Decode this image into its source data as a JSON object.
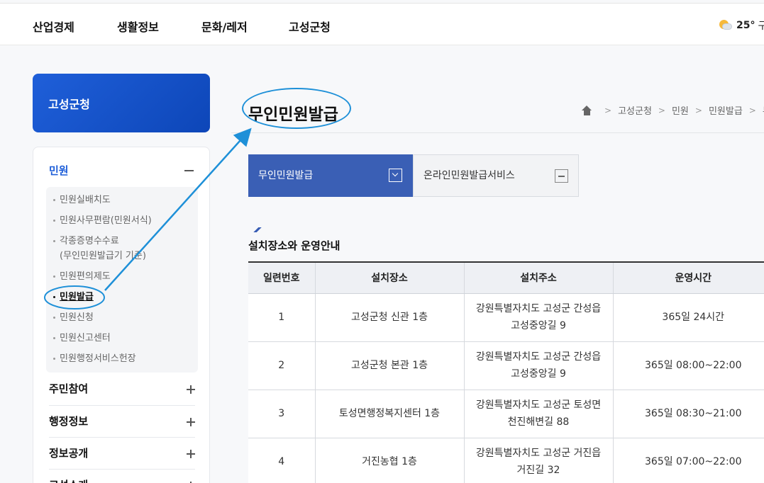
{
  "topnav": {
    "items": [
      "산업경제",
      "생활정보",
      "문화/레저",
      "고성군청"
    ],
    "weather_temp": "25°",
    "weather_extra": "구"
  },
  "sidebar": {
    "title": "고성군청",
    "section": "민원",
    "sub_items": [
      {
        "line1": "민원실배치도",
        "line2": ""
      },
      {
        "line1": "민원사무편람(민원서식)",
        "line2": ""
      },
      {
        "line1": "각종증명수수료",
        "line2": "(무인민원발급기 기준)"
      },
      {
        "line1": "민원편의제도",
        "line2": ""
      },
      {
        "line1": "민원발급",
        "line2": ""
      },
      {
        "line1": "민원신청",
        "line2": ""
      },
      {
        "line1": "민원신고센터",
        "line2": ""
      },
      {
        "line1": "민원행정서비스헌장",
        "line2": ""
      }
    ],
    "menus": [
      "주민참여",
      "행정정보",
      "정보공개",
      "고성소개"
    ]
  },
  "main": {
    "page_title": "무인민원발급",
    "breadcrumb": [
      "고성군청",
      "민원",
      "민원발급",
      "무"
    ],
    "tabs": [
      {
        "label": "무인민원발급"
      },
      {
        "label": "온라인민원발급서비스"
      }
    ],
    "section_title": "설치장소와 운영안내",
    "table": {
      "headers": [
        "일련번호",
        "설치장소",
        "설치주소",
        "운영시간"
      ],
      "rows": [
        {
          "no": "1",
          "place": "고성군청 신관 1층",
          "addr1": "강원특별자치도 고성군 간성읍",
          "addr2": "고성중앙길 9",
          "hours": "365일 24시간"
        },
        {
          "no": "2",
          "place": "고성군청 본관 1층",
          "addr1": "강원특별자치도 고성군 간성읍",
          "addr2": "고성중앙길 9",
          "hours": "365일 08:00~22:00"
        },
        {
          "no": "3",
          "place": "토성면행정복지센터 1층",
          "addr1": "강원특별자치도 고성군 토성면",
          "addr2": "천진해변길 88",
          "hours": "365일 08:30~21:00"
        },
        {
          "no": "4",
          "place": "거진농협 1층",
          "addr1": "강원특별자치도 고성군 거진읍",
          "addr2": "거진길 32",
          "hours": "365일 07:00~22:00"
        }
      ]
    }
  },
  "annotation": {
    "color": "#1e90d8"
  }
}
